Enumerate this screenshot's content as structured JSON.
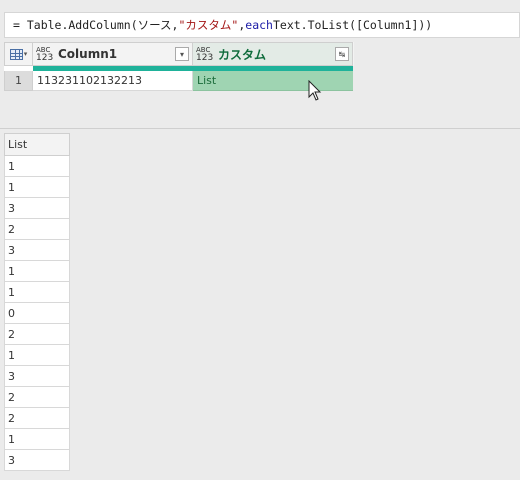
{
  "formula": {
    "prefix": "= Table.AddColumn(ソース, ",
    "string": "\"カスタム\"",
    "sep": ", ",
    "keyword": "each",
    "rest": " Text.ToList([Column1]))"
  },
  "table": {
    "type_icon_top": "ABC",
    "type_icon_bottom": "123",
    "columns": [
      {
        "label": "Column1",
        "button": "▾"
      },
      {
        "label": "カスタム",
        "button": "↹"
      }
    ],
    "rows": [
      {
        "num": "1",
        "col1": "113231102132213",
        "col2": "List"
      }
    ]
  },
  "list": {
    "header": "List",
    "items": [
      "1",
      "1",
      "3",
      "2",
      "3",
      "1",
      "1",
      "0",
      "2",
      "1",
      "3",
      "2",
      "2",
      "1",
      "3"
    ]
  },
  "colors": {
    "quality_bar": "#1fb29a",
    "selected_cell": "#9fd4b2",
    "custom_header_text": "#0e6b3b"
  }
}
